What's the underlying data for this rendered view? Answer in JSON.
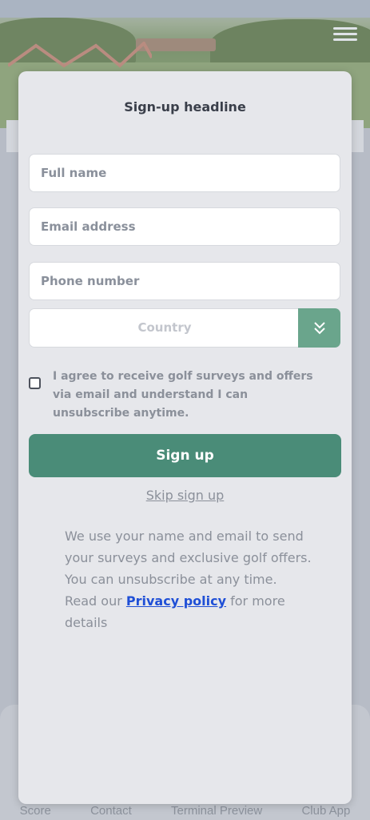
{
  "form": {
    "headline": "Sign-up headline",
    "full_name_placeholder": "Full name",
    "email_placeholder": "Email address",
    "phone_placeholder": "Phone number",
    "country_label": "Country",
    "consent_text": "I agree to receive golf surveys and offers via email and understand I can unsubscribe anytime.",
    "consent_checked": false,
    "signup_label": "Sign up",
    "skip_label": "Skip sign up",
    "info_line1": "We use your name and email to send your surveys and exclusive golf offers.",
    "info_line2": "You can unsubscribe at any time.",
    "info_read_prefix": "Read our",
    "privacy_link": "Privacy policy",
    "info_read_suffix": "for more details"
  },
  "bottom_nav": {
    "items": [
      "Score",
      "Contact",
      "Terminal Preview",
      "Club App"
    ]
  },
  "colors": {
    "accent": "#4a8c78",
    "select_button": "#6aa58c",
    "link": "#1f4fd6",
    "card_bg": "#e6e7eb"
  },
  "icons": {
    "menu": "hamburger-icon",
    "select": "double-chevron-down-icon"
  }
}
